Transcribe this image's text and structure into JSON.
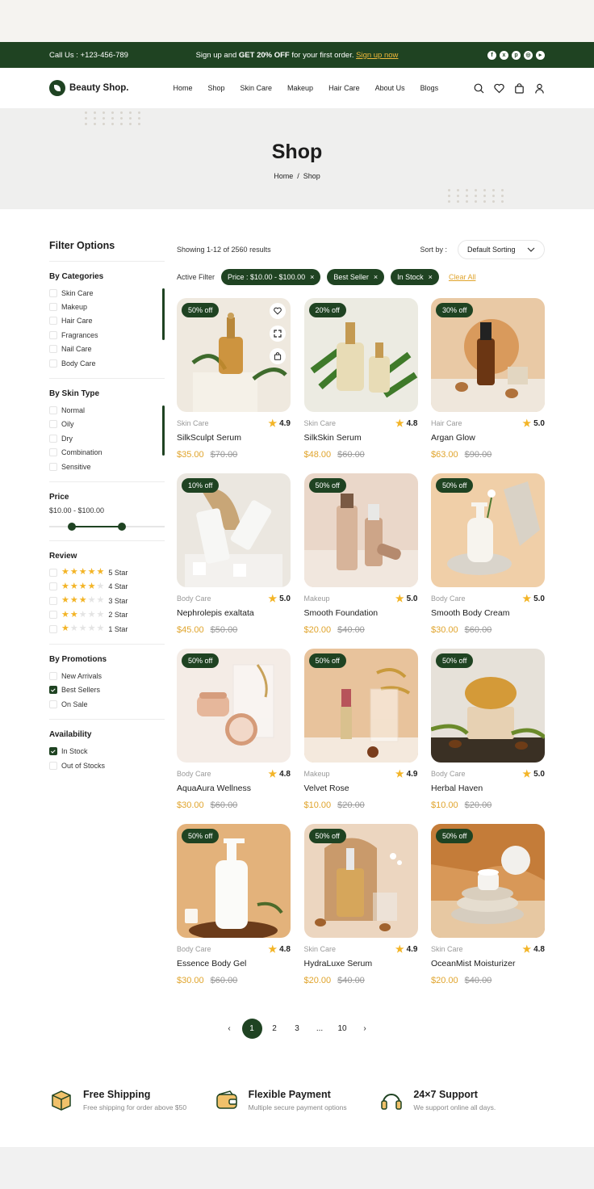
{
  "topbar": {
    "call": "Call Us : +123-456-789",
    "promo_prefix": "Sign up and ",
    "promo_bold": "GET 20% OFF",
    "promo_suffix": " for your first order. ",
    "promo_link": "Sign up now",
    "socials": [
      "facebook-icon",
      "x-icon",
      "pinterest-icon",
      "instagram-icon",
      "youtube-icon"
    ]
  },
  "header": {
    "logo": "Beauty Shop.",
    "nav": [
      "Home",
      "Shop",
      "Skin Care",
      "Makeup",
      "Hair Care",
      "About Us",
      "Blogs"
    ],
    "icons": [
      "search-icon",
      "heart-icon",
      "bag-icon",
      "user-icon"
    ]
  },
  "hero": {
    "title": "Shop",
    "crumb_home": "Home",
    "crumb_sep": "/",
    "crumb_current": "Shop"
  },
  "sidebar": {
    "title": "Filter Options",
    "categories": {
      "title": "By Categories",
      "items": [
        "Skin Care",
        "Makeup",
        "Hair Care",
        "Fragrances",
        "Nail Care",
        "Body Care"
      ]
    },
    "skin_type": {
      "title": "By Skin Type",
      "items": [
        "Normal",
        "Oily",
        "Dry",
        "Combination",
        "Sensitive"
      ]
    },
    "price": {
      "title": "Price",
      "range": "$10.00 - $100.00",
      "min_fraction": 0.2,
      "max_fraction": 0.64
    },
    "review": {
      "title": "Review",
      "items": [
        {
          "label": "5 Star",
          "stars": 5
        },
        {
          "label": "4 Star",
          "stars": 4
        },
        {
          "label": "3 Star",
          "stars": 3
        },
        {
          "label": "2 Star",
          "stars": 2
        },
        {
          "label": "1 Star",
          "stars": 1
        }
      ]
    },
    "promotions": {
      "title": "By Promotions",
      "items": [
        {
          "label": "New Arrivals",
          "checked": false
        },
        {
          "label": "Best Sellers",
          "checked": true
        },
        {
          "label": "On Sale",
          "checked": false
        }
      ]
    },
    "availability": {
      "title": "Availability",
      "items": [
        {
          "label": "In Stock",
          "checked": true
        },
        {
          "label": "Out of Stocks",
          "checked": false
        }
      ]
    }
  },
  "toolbar": {
    "results": "Showing 1-12 of 2560 results",
    "sort_label": "Sort by :",
    "sort_value": "Default Sorting"
  },
  "active_filters": {
    "label": "Active Filter",
    "chips": [
      "Price : $10.00 - $100.00",
      "Best Seller",
      "In Stock"
    ],
    "clear": "Clear All"
  },
  "products": [
    {
      "badge": "50% off",
      "category": "Skin Care",
      "rating": "4.9",
      "name": "SilkSculpt Serum",
      "price": "$35.00",
      "old": "$70.00",
      "bg": "#efe9df",
      "accent": "#c98b2e",
      "kind": "dropper",
      "tools": true
    },
    {
      "badge": "20% off",
      "category": "Skin Care",
      "rating": "4.8",
      "name": "SilkSkin Serum",
      "price": "$48.00",
      "old": "$60.00",
      "bg": "#ecebe2",
      "accent": "#e8dcb6",
      "kind": "bottles"
    },
    {
      "badge": "30% off",
      "category": "Hair Care",
      "rating": "5.0",
      "name": "Argan Glow",
      "price": "$63.00",
      "old": "$90.00",
      "bg": "#e9c9a5",
      "accent": "#6b3613",
      "kind": "amber"
    },
    {
      "badge": "10% off",
      "category": "Body Care",
      "rating": "5.0",
      "name": "Nephrolepis exaltata",
      "price": "$45.00",
      "old": "$50.00",
      "bg": "#ebe7e0",
      "accent": "#f7f7f5",
      "kind": "tubes"
    },
    {
      "badge": "50% off",
      "category": "Makeup",
      "rating": "5.0",
      "name": "Smooth Foundation",
      "price": "$20.00",
      "old": "$40.00",
      "bg": "#ead7c9",
      "accent": "#d7b49a",
      "kind": "foundation"
    },
    {
      "badge": "50% off",
      "category": "Body Care",
      "rating": "5.0",
      "name": "Smooth Body Cream",
      "price": "$30.00",
      "old": "$60.00",
      "bg": "#f0cfa8",
      "accent": "#f7f4ee",
      "kind": "pump"
    },
    {
      "badge": "50% off",
      "category": "Body Care",
      "rating": "4.8",
      "name": "AquaAura Wellness",
      "price": "$30.00",
      "old": "$60.00",
      "bg": "#f4ece6",
      "accent": "#e6b79b",
      "kind": "jar"
    },
    {
      "badge": "50% off",
      "category": "Makeup",
      "rating": "4.9",
      "name": "Velvet Rose",
      "price": "$10.00",
      "old": "$20.00",
      "bg": "#e8c39c",
      "accent": "#b7545a",
      "kind": "lipstick"
    },
    {
      "badge": "50% off",
      "category": "Body Care",
      "rating": "5.0",
      "name": "Herbal Haven",
      "price": "$10.00",
      "old": "$20.00",
      "bg": "#e6e1d9",
      "accent": "#d49a38",
      "kind": "soap"
    },
    {
      "badge": "50% off",
      "category": "Body Care",
      "rating": "4.8",
      "name": "Essence Body Gel",
      "price": "$30.00",
      "old": "$60.00",
      "bg": "#e3b27b",
      "accent": "#fbfbf9",
      "kind": "gel"
    },
    {
      "badge": "50% off",
      "category": "Skin Care",
      "rating": "4.9",
      "name": "HydraLuxe Serum",
      "price": "$20.00",
      "old": "$40.00",
      "bg": "#ecd6c0",
      "accent": "#d8a858",
      "kind": "serum"
    },
    {
      "badge": "50% off",
      "category": "Skin Care",
      "rating": "4.8",
      "name": "OceanMist Moisturizer",
      "price": "$20.00",
      "old": "$40.00",
      "bg": "#d89858",
      "accent": "#f5f3ef",
      "kind": "stones"
    }
  ],
  "pagination": {
    "prev": "‹",
    "pages": [
      "1",
      "2",
      "3",
      "...",
      "10"
    ],
    "current": "1",
    "next": "›"
  },
  "features": [
    {
      "icon": "box-icon",
      "title": "Free Shipping",
      "text": "Free shipping for order above $50"
    },
    {
      "icon": "wallet-icon",
      "title": "Flexible Payment",
      "text": "Multiple secure payment options"
    },
    {
      "icon": "headset-icon",
      "title": "24×7 Support",
      "text": "We support online all days."
    }
  ],
  "colors": {
    "brand": "#1f4322",
    "accent": "#e0a42c",
    "star": "#f3b426"
  }
}
